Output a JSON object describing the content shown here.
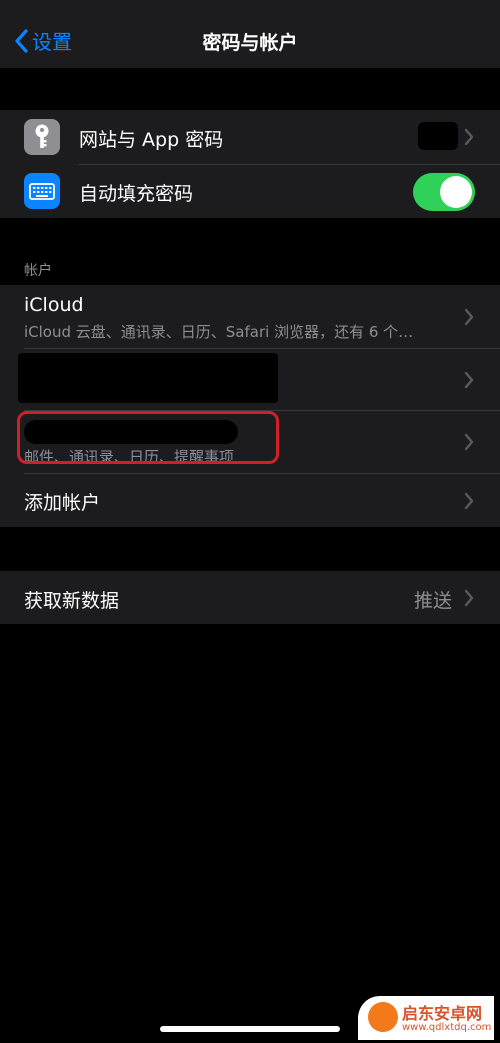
{
  "nav": {
    "back_label": "设置",
    "title": "密码与帐户"
  },
  "passwords": {
    "website_app_passwords": "网站与 App 密码",
    "autofill_passwords": "自动填充密码",
    "autofill_enabled": true
  },
  "accounts": {
    "section_header": "帐户",
    "icloud": {
      "label": "iCloud",
      "detail": "iCloud 云盘、通讯录、日历、Safari 浏览器，还有 6 个…"
    },
    "account3": {
      "detail": "邮件、通讯录、日历、提醒事项"
    },
    "add_account": "添加帐户"
  },
  "fetch": {
    "label": "获取新数据",
    "value": "推送"
  },
  "watermark": {
    "name": "启东安卓网",
    "url": "www.qdlxtdq.com"
  },
  "colors": {
    "accent": "#0a84ff",
    "toggle_on": "#30d158",
    "highlight": "#d11f2a",
    "key_icon_bg": "#8e8e93",
    "keyboard_icon_bg": "#0a84ff"
  }
}
